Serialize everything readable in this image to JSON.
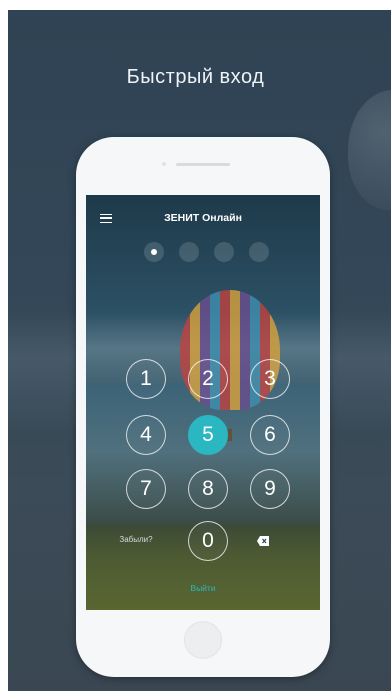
{
  "promo": {
    "headline": "Быстрый вход"
  },
  "app": {
    "title": "ЗЕНИТ Онлайн",
    "menu_icon": "hamburger-menu-icon"
  },
  "pin": {
    "length": 4,
    "entered": 1
  },
  "keypad": {
    "keys": [
      "1",
      "2",
      "3",
      "4",
      "5",
      "6",
      "7",
      "8",
      "9",
      "0"
    ],
    "active_key": "5",
    "forgot_label": "Забыли?",
    "backspace_icon": "backspace-icon"
  },
  "footer": {
    "logout_label": "Выйти"
  },
  "colors": {
    "accent": "#2bb7c1",
    "background": "#334758"
  }
}
